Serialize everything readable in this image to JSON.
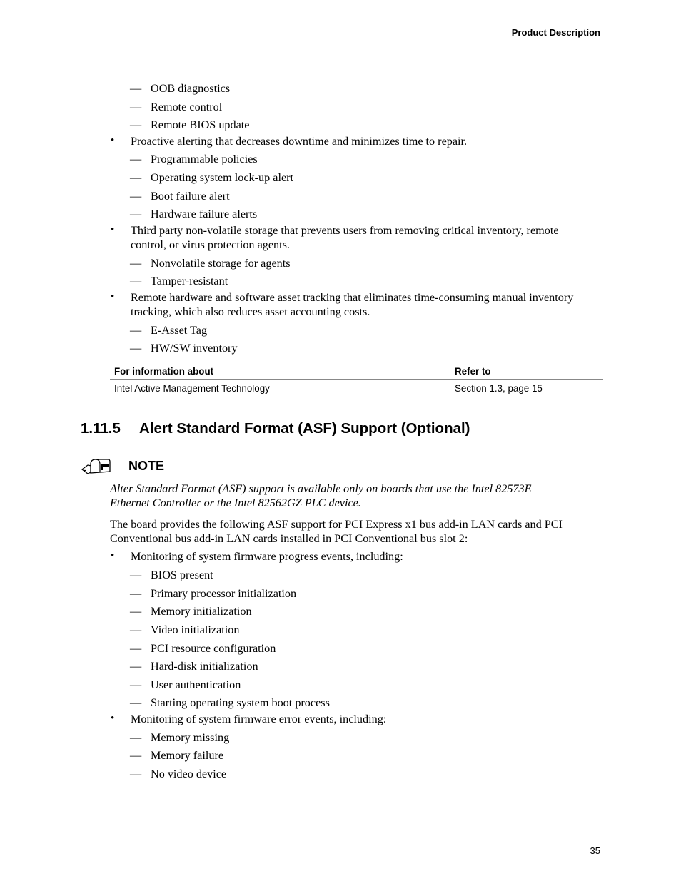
{
  "header": {
    "running_title": "Product Description"
  },
  "top_list": {
    "items": [
      {
        "type": "dash",
        "text": "OOB diagnostics"
      },
      {
        "type": "dash",
        "text": "Remote control"
      },
      {
        "type": "dash",
        "text": "Remote BIOS update"
      },
      {
        "type": "bullet",
        "text": "Proactive alerting that decreases downtime and minimizes time to repair."
      },
      {
        "type": "dash",
        "text": "Programmable policies"
      },
      {
        "type": "dash",
        "text": "Operating system lock-up alert"
      },
      {
        "type": "dash",
        "text": "Boot failure alert"
      },
      {
        "type": "dash",
        "text": "Hardware failure alerts"
      },
      {
        "type": "bullet",
        "line1": "Third party non-volatile storage that prevents users from removing critical inventory, remote",
        "line2": "control, or virus protection agents."
      },
      {
        "type": "dash",
        "text": "Nonvolatile storage for agents"
      },
      {
        "type": "dash",
        "text": "Tamper-resistant"
      },
      {
        "type": "bullet",
        "line1": "Remote hardware and software asset tracking that eliminates time-consuming manual inventory",
        "line2": "tracking, which also reduces asset accounting costs."
      },
      {
        "type": "dash",
        "text": "E-Asset Tag"
      },
      {
        "type": "dash",
        "text": "HW/SW inventory"
      }
    ]
  },
  "reference_table": {
    "headers": [
      "For information about",
      "Refer to"
    ],
    "rows": [
      [
        "Intel Active Management Technology",
        "Section 1.3, page 15"
      ]
    ]
  },
  "section": {
    "number": "1.11.5",
    "title": "Alert Standard Format (ASF) Support (Optional)"
  },
  "note": {
    "icon": "mailbox-icon",
    "label": "NOTE",
    "line1": "Alter Standard Format (ASF) support is available only on boards that use the Intel 82573E",
    "line2": "Ethernet Controller or the Intel 82562GZ PLC device."
  },
  "body": {
    "intro_line1": "The board provides the following ASF support for PCI Express x1 bus add-in LAN cards and PCI",
    "intro_line2": "Conventional bus add-in LAN cards installed in PCI Conventional bus slot 2:",
    "progress_bullet": "Monitoring of system firmware progress events, including:",
    "progress_items": [
      "BIOS present",
      "Primary processor initialization",
      "Memory initialization",
      "Video initialization",
      "PCI resource configuration",
      "Hard-disk initialization",
      "User authentication",
      "Starting operating system boot process"
    ],
    "error_bullet": "Monitoring of system firmware error events, including:",
    "error_items": [
      "Memory missing",
      "Memory failure",
      "No video device"
    ]
  },
  "footer": {
    "page_number": "35"
  }
}
